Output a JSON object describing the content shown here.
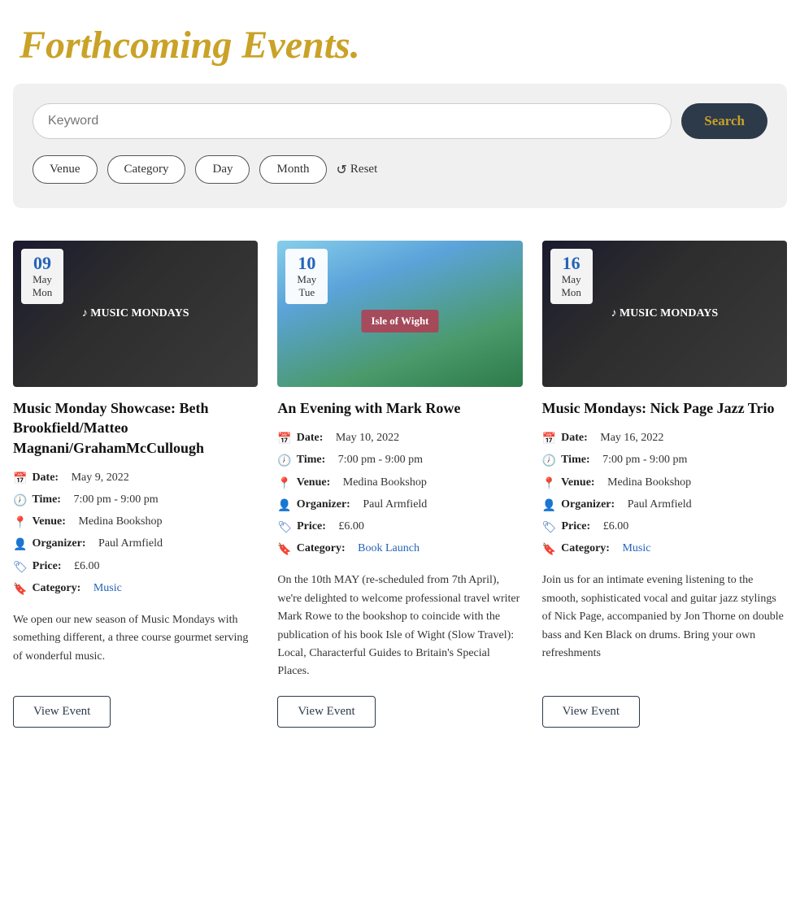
{
  "page": {
    "title": "Forthcoming Events."
  },
  "search": {
    "placeholder": "Keyword",
    "button_label": "Search"
  },
  "filters": {
    "venue_label": "Venue",
    "category_label": "Category",
    "day_label": "Day",
    "month_label": "Month",
    "reset_label": "Reset"
  },
  "events": [
    {
      "id": "event-1",
      "date_num": "09",
      "date_month": "May",
      "date_day": "Mon",
      "title": "Music Monday Showcase: Beth Brookfield/Matteo Magnani/GrahamMcCullough",
      "date_full": "May 9, 2022",
      "time": "7:00 pm - 9:00 pm",
      "venue": "Medina Bookshop",
      "organizer": "Paul Armfield",
      "price": "£6.00",
      "category": "Music",
      "description": "We open our new season of Music Mondays with something different, a three course gourmet serving of wonderful music.",
      "image_class": "img-music-monday",
      "button_label": "View Event"
    },
    {
      "id": "event-2",
      "date_num": "10",
      "date_month": "May",
      "date_day": "Tue",
      "title": "An Evening with Mark Rowe",
      "date_full": "May 10, 2022",
      "time": "7:00 pm - 9:00 pm",
      "venue": "Medina Bookshop",
      "organizer": "Paul Armfield",
      "price": "£6.00",
      "category": "Book Launch",
      "description": "On the 10th MAY (re-scheduled from 7th April), we're delighted to welcome professional travel writer Mark Rowe to the bookshop to coincide with the publication of his book Isle of Wight (Slow Travel): Local, Characterful Guides to Britain's Special Places.",
      "image_class": "img-mark-rowe",
      "button_label": "View Event"
    },
    {
      "id": "event-3",
      "date_num": "16",
      "date_month": "May",
      "date_day": "Mon",
      "title": "Music Mondays: Nick Page Jazz Trio",
      "date_full": "May 16, 2022",
      "time": "7:00 pm - 9:00 pm",
      "venue": "Medina Bookshop",
      "organizer": "Paul Armfield",
      "price": "£6.00",
      "category": "Music",
      "description": "Join us for an intimate evening listening to the smooth, sophisticated vocal and guitar jazz stylings of Nick Page, accompanied by Jon Thorne on double bass and Ken Black on drums. Bring your own refreshments",
      "image_class": "img-nick-page",
      "button_label": "View Event"
    }
  ],
  "meta_labels": {
    "date": "Date:",
    "time": "Time:",
    "venue": "Venue:",
    "organizer": "Organizer:",
    "price": "Price:",
    "category": "Category:"
  }
}
